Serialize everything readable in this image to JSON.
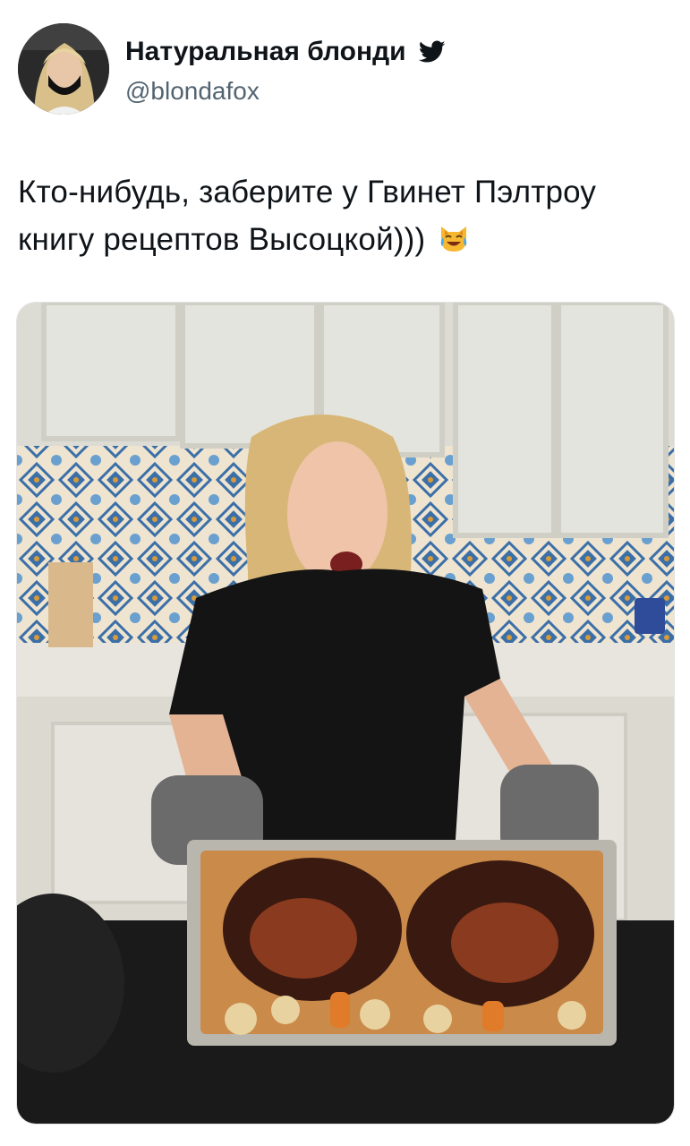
{
  "tweet": {
    "display_name": "Натуральная блонди",
    "handle": "@blondafox",
    "text": "Кто-нибудь, заберите у Гвинет Пэлтроу книгу рецептов Высоцкой)))",
    "emoji_icon": "cat-with-tears-of-joy-icon",
    "verified_icon": "twitter-bird-icon",
    "accent_color": "#1d9bf0"
  }
}
